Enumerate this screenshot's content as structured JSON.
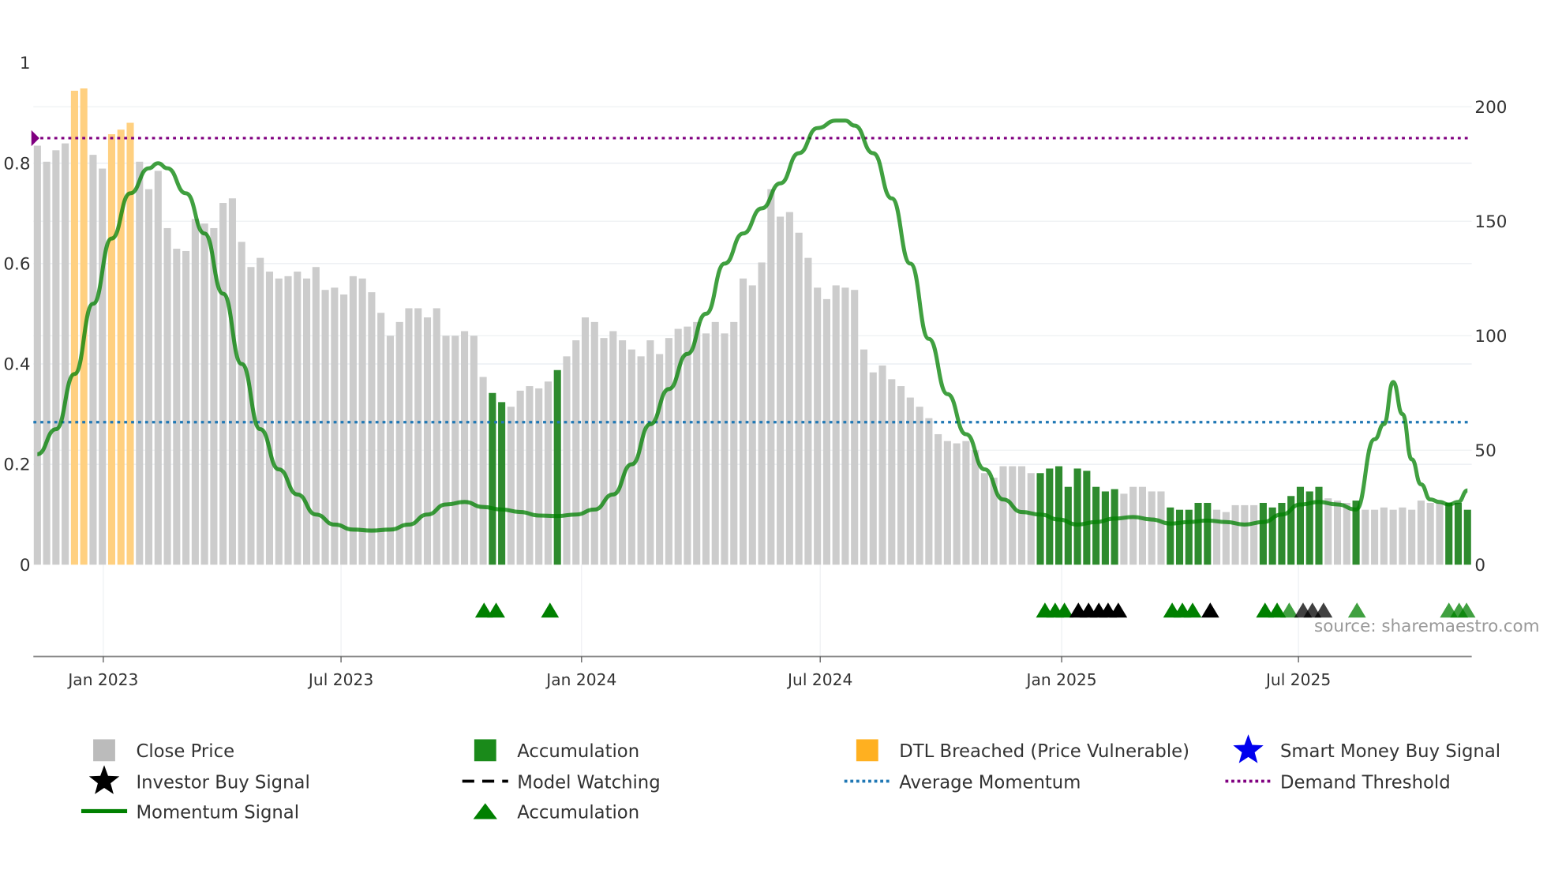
{
  "chart_data": {
    "type": "bar",
    "title": "",
    "source": "source: sharemaestro.com",
    "left_axis": {
      "ticks": [
        "0",
        "0.2",
        "0.4",
        "0.6",
        "0.8",
        "1"
      ],
      "values": [
        0,
        0.2,
        0.4,
        0.6,
        0.8,
        1
      ],
      "range": [
        0,
        1
      ]
    },
    "right_axis": {
      "ticks": [
        "0",
        "50",
        "100",
        "150",
        "200"
      ],
      "values": [
        0,
        50,
        100,
        150,
        200
      ],
      "range": [
        0,
        219
      ]
    },
    "x_ticks": [
      {
        "label": "Jan 2023",
        "week": 7.1
      },
      {
        "label": "Jul 2023",
        "week": 32.7
      },
      {
        "label": "Jan 2024",
        "week": 58.6
      },
      {
        "label": "Jul 2024",
        "week": 84.3
      },
      {
        "label": "Jan 2025",
        "week": 110.3
      },
      {
        "label": "Jul 2025",
        "week": 135.8
      }
    ],
    "close_price": [
      183,
      176,
      181,
      184,
      207,
      208,
      179,
      173,
      188,
      190,
      193,
      176,
      164,
      172,
      147,
      138,
      137,
      151,
      149,
      147,
      158,
      160,
      141,
      130,
      134,
      128,
      125,
      126,
      128,
      125,
      130,
      120,
      121,
      118,
      126,
      125,
      119,
      110,
      100,
      106,
      112,
      112,
      108,
      112,
      100,
      100,
      102,
      100,
      82,
      75,
      71,
      69,
      76,
      78,
      77,
      80,
      85,
      91,
      98,
      108,
      106,
      99,
      102,
      98,
      94,
      91,
      98,
      92,
      99,
      103,
      104,
      106,
      101,
      106,
      101,
      106,
      125,
      122,
      132,
      164,
      152,
      154,
      145,
      134,
      121,
      116,
      122,
      121,
      120,
      94,
      84,
      87,
      81,
      78,
      73,
      69,
      64,
      57,
      54,
      53,
      54,
      50,
      40,
      38,
      43,
      43,
      43,
      40,
      40,
      42,
      43,
      34,
      42,
      41,
      34,
      32,
      33,
      31,
      34,
      34,
      32,
      32,
      25,
      24,
      24,
      27,
      27,
      24,
      23,
      26,
      26,
      26,
      27,
      25,
      27,
      30,
      34,
      32,
      34,
      29,
      28,
      27,
      28,
      24,
      24,
      25,
      24,
      25,
      24,
      28,
      27,
      27,
      27,
      27,
      24
    ],
    "accumulation_weeks": [
      49,
      50,
      56,
      108,
      109,
      110,
      111,
      112,
      113,
      114,
      115,
      116,
      122,
      123,
      124,
      125,
      126,
      132,
      133,
      134,
      135,
      136,
      137,
      138,
      142,
      152,
      153,
      154
    ],
    "dtl_breached_weeks": [
      4,
      5,
      8,
      9,
      10
    ],
    "momentum": [
      [
        0,
        0.22
      ],
      [
        2,
        0.27
      ],
      [
        4,
        0.38
      ],
      [
        6,
        0.52
      ],
      [
        8,
        0.65
      ],
      [
        10,
        0.74
      ],
      [
        12,
        0.79
      ],
      [
        13,
        0.8
      ],
      [
        14,
        0.79
      ],
      [
        16,
        0.74
      ],
      [
        18,
        0.66
      ],
      [
        20,
        0.54
      ],
      [
        22,
        0.4
      ],
      [
        24,
        0.27
      ],
      [
        26,
        0.19
      ],
      [
        28,
        0.14
      ],
      [
        30,
        0.1
      ],
      [
        32,
        0.08
      ],
      [
        34,
        0.07
      ],
      [
        36,
        0.068
      ],
      [
        38,
        0.07
      ],
      [
        40,
        0.08
      ],
      [
        42,
        0.1
      ],
      [
        44,
        0.12
      ],
      [
        46,
        0.125
      ],
      [
        48,
        0.115
      ],
      [
        50,
        0.11
      ],
      [
        52,
        0.105
      ],
      [
        54,
        0.098
      ],
      [
        56,
        0.097
      ],
      [
        58,
        0.1
      ],
      [
        60,
        0.11
      ],
      [
        62,
        0.14
      ],
      [
        64,
        0.2
      ],
      [
        66,
        0.28
      ],
      [
        68,
        0.35
      ],
      [
        70,
        0.42
      ],
      [
        72,
        0.5
      ],
      [
        74,
        0.6
      ],
      [
        76,
        0.66
      ],
      [
        78,
        0.71
      ],
      [
        80,
        0.76
      ],
      [
        82,
        0.82
      ],
      [
        84,
        0.87
      ],
      [
        86,
        0.885
      ],
      [
        87,
        0.885
      ],
      [
        88,
        0.875
      ],
      [
        90,
        0.82
      ],
      [
        92,
        0.73
      ],
      [
        94,
        0.6
      ],
      [
        96,
        0.45
      ],
      [
        98,
        0.34
      ],
      [
        100,
        0.26
      ],
      [
        102,
        0.19
      ],
      [
        104,
        0.13
      ],
      [
        106,
        0.105
      ],
      [
        108,
        0.1
      ],
      [
        110,
        0.09
      ],
      [
        112,
        0.08
      ],
      [
        114,
        0.085
      ],
      [
        116,
        0.092
      ],
      [
        118,
        0.095
      ],
      [
        120,
        0.09
      ],
      [
        122,
        0.082
      ],
      [
        124,
        0.085
      ],
      [
        126,
        0.088
      ],
      [
        128,
        0.085
      ],
      [
        130,
        0.08
      ],
      [
        132,
        0.085
      ],
      [
        134,
        0.1
      ],
      [
        136,
        0.12
      ],
      [
        138,
        0.125
      ],
      [
        140,
        0.12
      ],
      [
        142,
        0.11
      ],
      [
        144,
        0.25
      ],
      [
        145,
        0.28
      ],
      [
        146,
        0.364
      ],
      [
        147,
        0.3
      ],
      [
        148,
        0.21
      ],
      [
        149,
        0.16
      ],
      [
        150,
        0.13
      ],
      [
        151,
        0.125
      ],
      [
        152,
        0.12
      ],
      [
        153,
        0.125
      ],
      [
        154,
        0.148
      ]
    ],
    "demand_threshold": 0.85,
    "average_momentum": 0.284,
    "signals": [
      {
        "week": 48.1,
        "type": "accumulation"
      },
      {
        "week": 49.4,
        "type": "accumulation"
      },
      {
        "week": 55.2,
        "type": "accumulation"
      },
      {
        "week": 108.5,
        "type": "accumulation"
      },
      {
        "week": 109.6,
        "type": "accumulation"
      },
      {
        "week": 110.6,
        "type": "accumulation"
      },
      {
        "week": 112.1,
        "type": "investor"
      },
      {
        "week": 113.2,
        "type": "investor"
      },
      {
        "week": 114.3,
        "type": "investor"
      },
      {
        "week": 115.3,
        "type": "investor"
      },
      {
        "week": 116.4,
        "type": "investor"
      },
      {
        "week": 122.2,
        "type": "accumulation"
      },
      {
        "week": 123.3,
        "type": "accumulation"
      },
      {
        "week": 124.4,
        "type": "accumulation"
      },
      {
        "week": 126.3,
        "type": "investor"
      },
      {
        "week": 132.2,
        "type": "accumulation"
      },
      {
        "week": 133.5,
        "type": "accumulation"
      },
      {
        "week": 134.8,
        "type": "accumulation-faded"
      },
      {
        "week": 136.3,
        "type": "investor-faded"
      },
      {
        "week": 137.3,
        "type": "investor-faded"
      },
      {
        "week": 138.5,
        "type": "investor-faded"
      },
      {
        "week": 142.1,
        "type": "accumulation-faded"
      },
      {
        "week": 152.0,
        "type": "accumulation-faded"
      },
      {
        "week": 153.1,
        "type": "accumulation-faded"
      },
      {
        "week": 153.9,
        "type": "accumulation-faded"
      }
    ],
    "legend": [
      {
        "label": "Close Price",
        "icon": "square",
        "color": "#bbbbbb"
      },
      {
        "label": "Accumulation",
        "icon": "square",
        "color": "#1a8a1a"
      },
      {
        "label": "DTL Breached (Price Vulnerable)",
        "icon": "square",
        "color": "#ffb020"
      },
      {
        "label": "Smart Money Buy Signal",
        "icon": "star",
        "color": "#0000ee"
      },
      {
        "label": "Investor Buy Signal",
        "icon": "star",
        "color": "#000000"
      },
      {
        "label": "Model Watching",
        "icon": "dash",
        "color": "#000000"
      },
      {
        "label": "Average Momentum",
        "icon": "dot",
        "color": "#1f77b4"
      },
      {
        "label": "Demand Threshold",
        "icon": "dot",
        "color": "#800080"
      },
      {
        "label": "Momentum Signal",
        "icon": "line",
        "color": "#008000"
      },
      {
        "label": "Accumulation",
        "icon": "triangle",
        "color": "#008000"
      }
    ],
    "legend_position": "bottom"
  },
  "colors": {
    "gray": "#cccccc",
    "green": "#2e8b2e",
    "orange": "#ffd080",
    "momentum": "#008000",
    "demand": "#800080",
    "avg": "#1f77b4"
  }
}
